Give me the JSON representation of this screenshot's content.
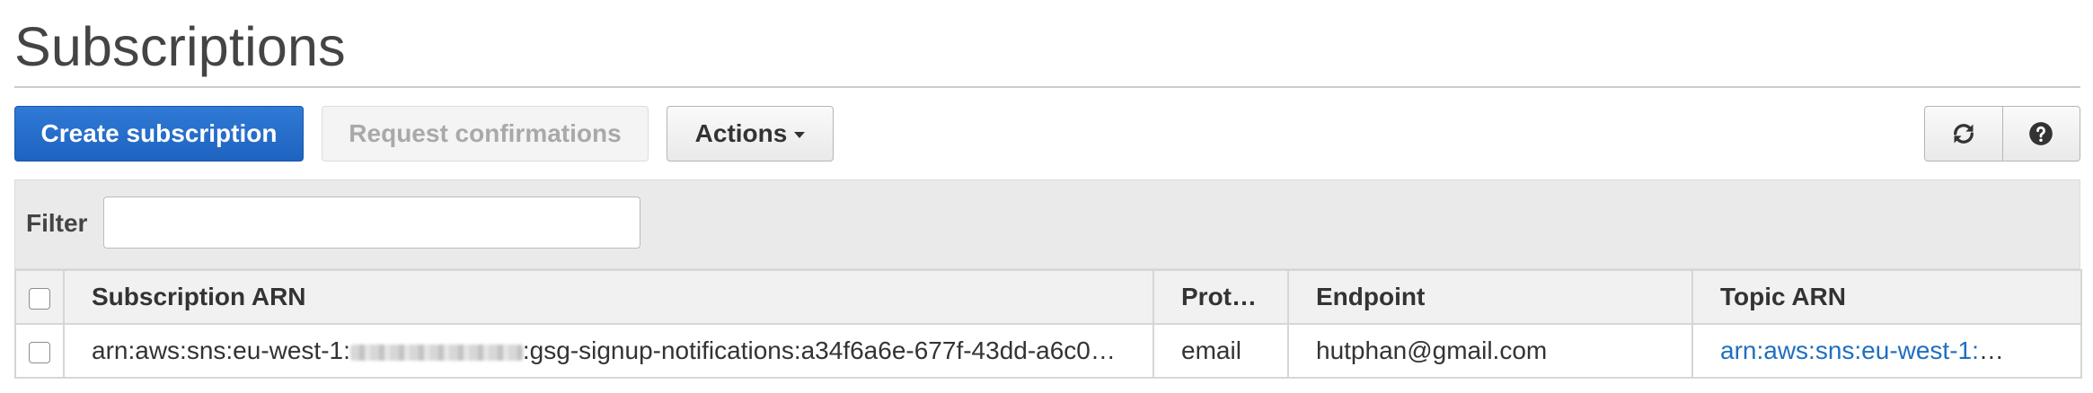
{
  "page": {
    "title": "Subscriptions"
  },
  "toolbar": {
    "create_label": "Create subscription",
    "request_label": "Request confirmations",
    "actions_label": "Actions",
    "refresh_icon": "refresh-icon",
    "help_icon": "help-icon"
  },
  "filter": {
    "label": "Filter",
    "value": "",
    "placeholder": ""
  },
  "table": {
    "columns": [
      "Subscription ARN",
      "Proto…",
      "Endpoint",
      "Topic ARN"
    ],
    "rows": [
      {
        "subscription_arn_prefix": "arn:aws:sns:eu-west-1:",
        "subscription_arn_suffix": ":gsg-signup-notifications:a34f6a6e-677f-43dd-a6c0…",
        "protocol": "email",
        "endpoint": "hutphan@gmail.com",
        "topic_arn_prefix": "arn:aws:sns:eu-west-1:"
      }
    ]
  },
  "colors": {
    "primary": "#1e63bf",
    "link": "#1f6fbf",
    "panel": "#eaeaea",
    "header": "#f1f1f1"
  }
}
